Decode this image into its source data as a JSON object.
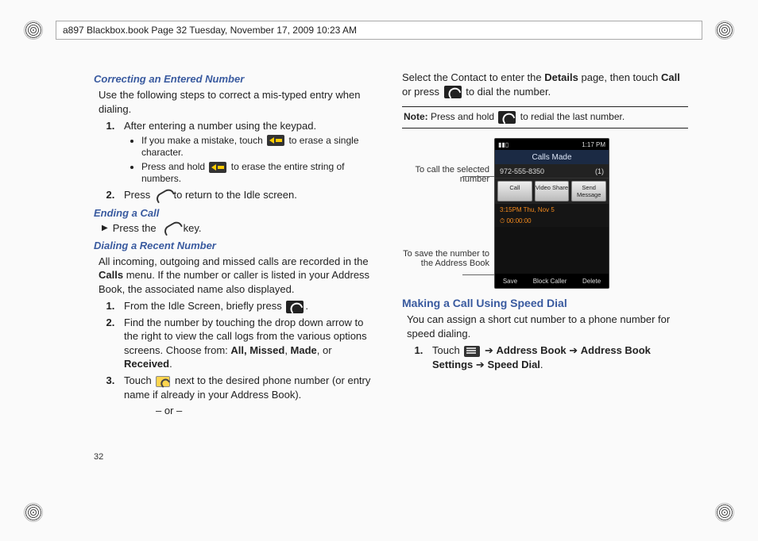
{
  "header": {
    "text": "a897 Blackbox.book  Page 32  Tuesday, November 17, 2009  10:23 AM"
  },
  "page_number": "32",
  "left": {
    "h1": "Correcting an Entered Number",
    "intro": "Use the following steps to correct a mis-typed entry when dialing.",
    "step1": "After entering a number using the keypad.",
    "b1a": "If you make a mistake, touch",
    "b1a2": "to erase a single character.",
    "b1b": "Press and hold",
    "b1b2": "to erase the entire string of numbers.",
    "step2a": "Press",
    "step2b": "to return to the Idle screen.",
    "h2": "Ending a Call",
    "end_a": "Press the",
    "end_b": "key.",
    "h3": "Dialing a Recent Number",
    "recent_intro_a": "All incoming, outgoing and missed calls are recorded in the ",
    "recent_intro_bold": "Calls",
    "recent_intro_b": " menu. If the number or caller is listed in your Address Book, the associated name also displayed.",
    "r1a": "From the Idle Screen, briefly press",
    "r2": "Find the number by touching the drop down arrow to the right to view the call logs from the various options screens. Choose from: ",
    "r2_opts": "All, Missed",
    "r2_c1": ", ",
    "r2_o2": "Made",
    "r2_c2": ", or ",
    "r2_o3": "Received",
    "r2_end": ".",
    "r3a": "Touch",
    "r3b": "next to the desired phone number (or entry name if already in your Address Book).",
    "or": "– or –"
  },
  "right": {
    "cont_a": "Select the Contact to enter the ",
    "cont_b": "Details",
    "cont_c": " page, then touch ",
    "cont_d": "Call",
    "cont_e": " or press",
    "cont_f": "to dial the number.",
    "note_a": "Note:",
    "note_b": " Press and hold",
    "note_c": "to redial the last number.",
    "callout1": "To call the selected number",
    "callout2": "To save the number to the Address Book",
    "h4": "Making a Call Using Speed Dial",
    "sd_intro": "You can assign a short cut number to a phone number for speed dialing.",
    "sd_1a": "Touch",
    "sd_arrow": "➔",
    "sd_p1": "Address Book",
    "sd_p2": "Address Book Settings",
    "sd_p3": "Speed Dial",
    "period": "."
  },
  "phone": {
    "time": "1:17 PM",
    "title": "Calls Made",
    "number": "972-555-8350",
    "count": "(1)",
    "btn1": "Call",
    "btn2": "Video Share",
    "btn3": "Send Message",
    "dt": "3:15PM Thu, Nov 5",
    "timer": "00:00:00",
    "bot1": "Save",
    "bot2": "Block Caller",
    "bot3": "Delete"
  }
}
